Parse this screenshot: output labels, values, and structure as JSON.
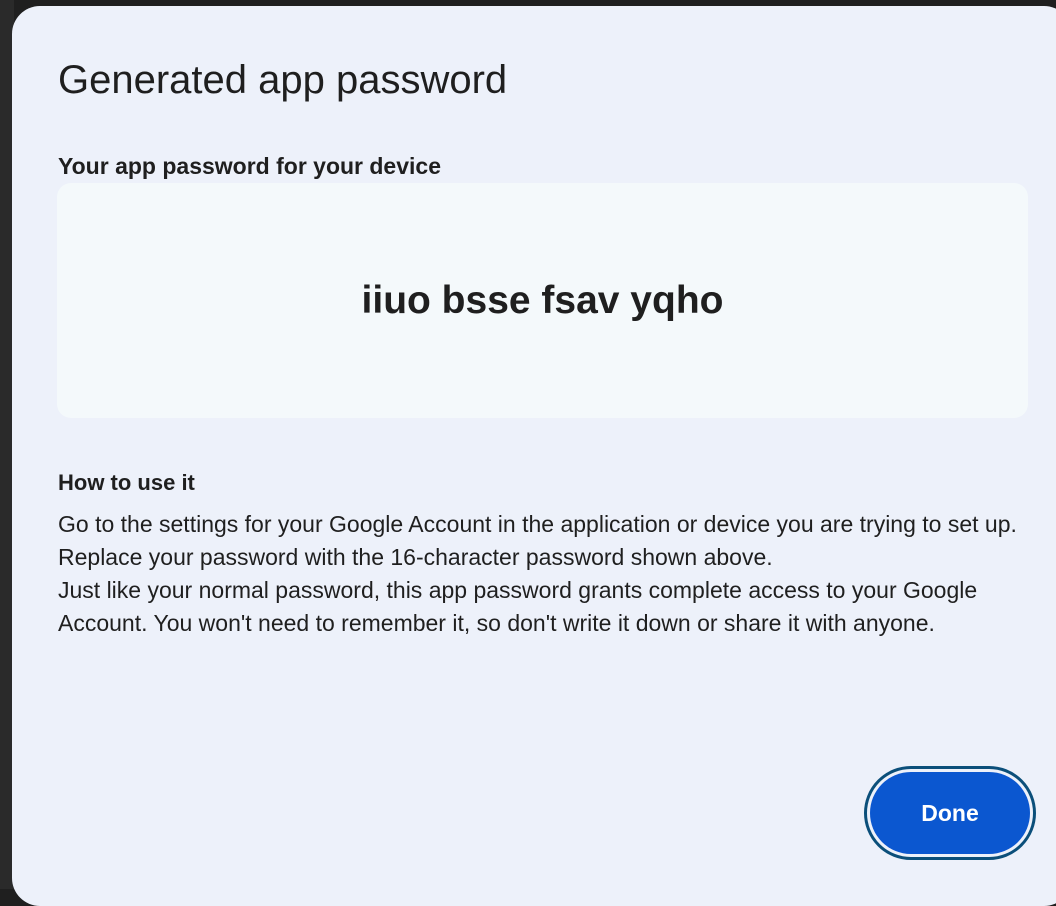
{
  "dialog": {
    "title": "Generated app password",
    "password_label": "Your app password for your device",
    "password": "iiuo bsse fsav yqho",
    "howto": {
      "heading": "How to use it",
      "paragraphs": [
        "Go to the settings for your Google Account in the application or device you are trying to set up. Replace your password with the 16-character password shown above.",
        "Just like your normal password, this app password grants complete access to your Google Account. You won't need to remember it, so don't write it down or share it with anyone."
      ]
    },
    "done_label": "Done"
  },
  "colors": {
    "dialog_background": "#edf1fa",
    "password_box_background": "#f4f9fb",
    "primary_button": "#0b57d0",
    "focus_ring": "#0b4f7a",
    "text": "#1f1f1f"
  }
}
